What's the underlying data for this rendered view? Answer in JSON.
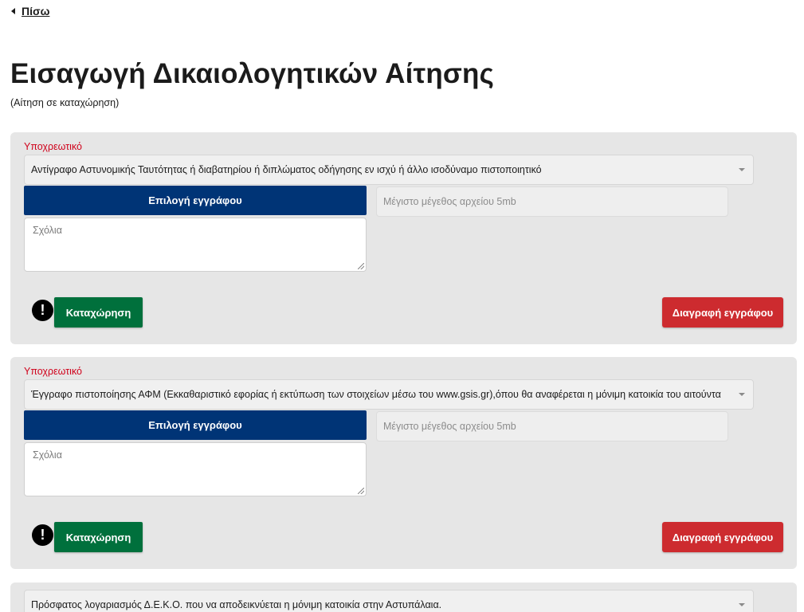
{
  "nav": {
    "back_label": "Πίσω"
  },
  "header": {
    "title": "Εισαγωγή Δικαιολογητικών Αίτησης",
    "subtitle": "(Αίτηση σε καταχώρηση)"
  },
  "colors": {
    "primary_blue": "#003476",
    "submit_green": "#00703c",
    "delete_red": "#cd2b2f",
    "required_red": "#d0021b",
    "card_bg": "#e6e6e6"
  },
  "documents": [
    {
      "required_label": "Υποχρεωτικό",
      "selected_document": "Αντίγραφο Αστυνομικής Ταυτότητας ή διαβατηρίου ή διπλώματος οδήγησης εν ισχύ ή άλλο ισοδύναμο πιστοποιητικό",
      "choose_file_label": "Επιλογή εγγράφου",
      "file_size_placeholder": "Μέγιστο μέγεθος αρχείου 5mb",
      "comments_placeholder": "Σχόλια",
      "alert_icon": "exclamation-icon",
      "submit_label": "Καταχώρηση",
      "delete_label": "Διαγραφή εγγράφου"
    },
    {
      "required_label": "Υποχρεωτικό",
      "selected_document": "Έγγραφο πιστοποίησης ΑΦΜ (Εκκαθαριστικό εφορίας ή εκτύπωση των στοιχείων μέσω του www.gsis.gr),όπου θα αναφέρεται η μόνιμη κατοικία του αιτούντα",
      "choose_file_label": "Επιλογή εγγράφου",
      "file_size_placeholder": "Μέγιστο μέγεθος αρχείου 5mb",
      "comments_placeholder": "Σχόλια",
      "alert_icon": "exclamation-icon",
      "submit_label": "Καταχώρηση",
      "delete_label": "Διαγραφή εγγράφου"
    },
    {
      "selected_document": "Πρόσφατος λογαριασμός Δ.Ε.Κ.Ο. που να αποδεικνύεται η μόνιμη κατοικία στην Αστυπάλαια."
    }
  ]
}
